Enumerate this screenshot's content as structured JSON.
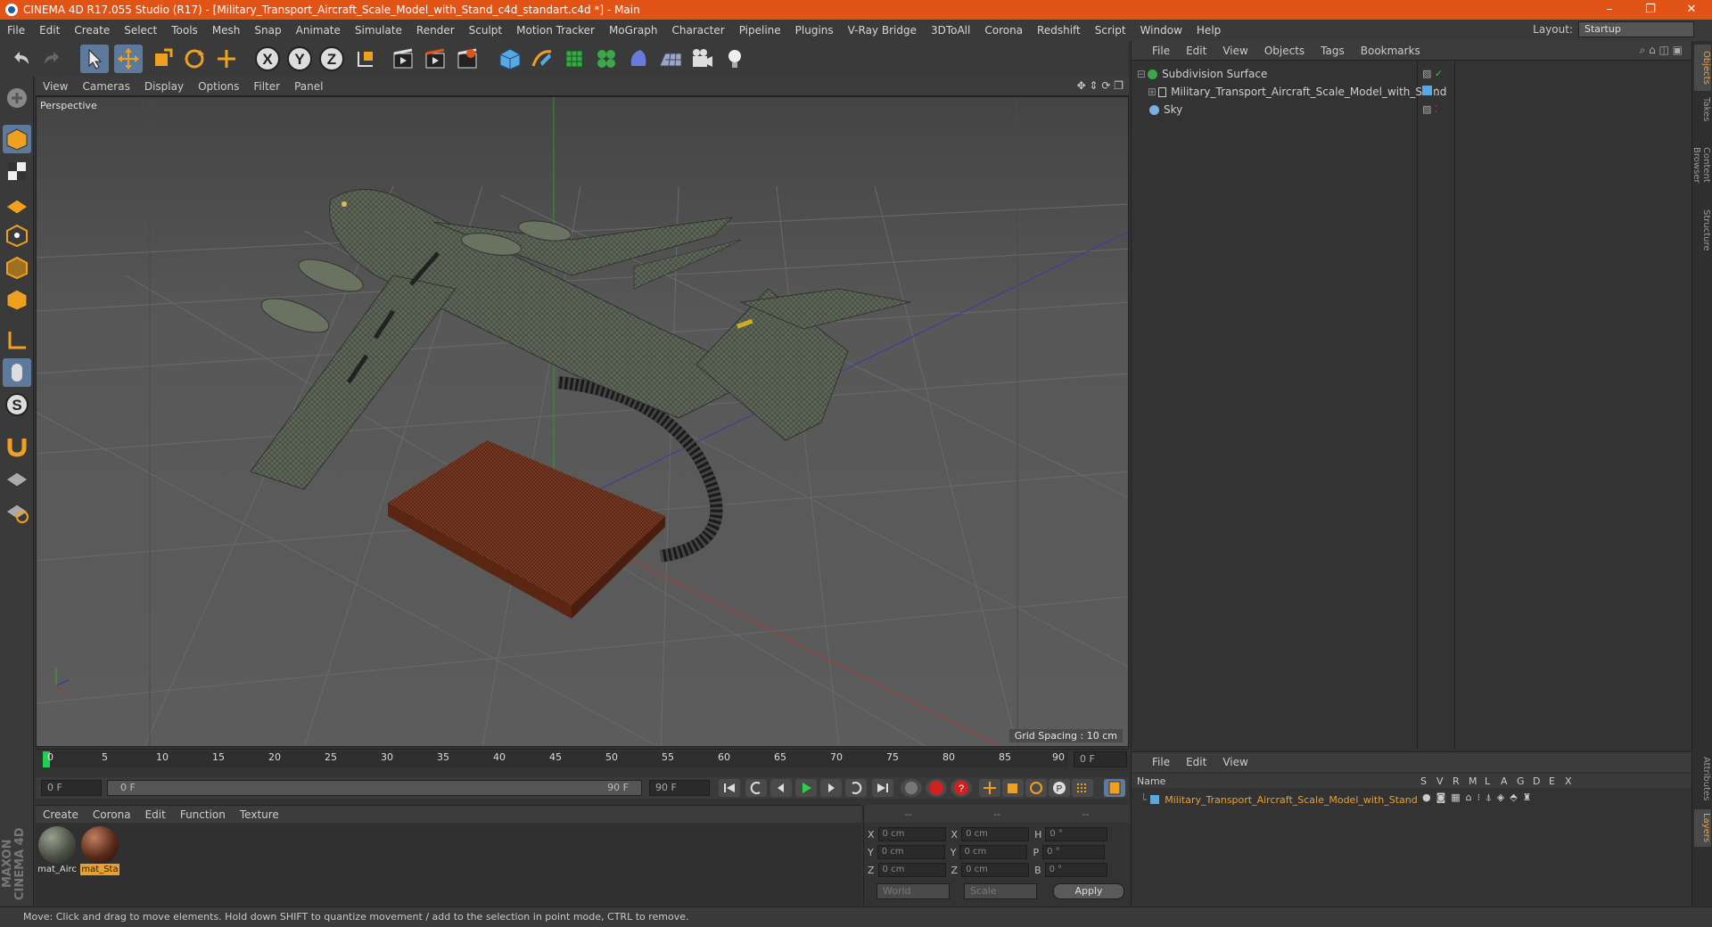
{
  "window": {
    "title": "CINEMA 4D R17.055 Studio (R17) - [Military_Transport_Aircraft_Scale_Model_with_Stand_c4d_standart.c4d *] - Main",
    "minimize": "–",
    "restore": "❐",
    "close": "✕"
  },
  "menubar": {
    "items": [
      "File",
      "Edit",
      "Create",
      "Select",
      "Tools",
      "Mesh",
      "Snap",
      "Animate",
      "Simulate",
      "Render",
      "Sculpt",
      "Motion Tracker",
      "MoGraph",
      "Character",
      "Pipeline",
      "Plugins",
      "V-Ray Bridge",
      "3DToAll",
      "Corona",
      "Redshift",
      "Script",
      "Window",
      "Help"
    ],
    "layout_label": "Layout:",
    "layout_value": "Startup"
  },
  "toolbar": {
    "axis_x": "X",
    "axis_y": "Y",
    "axis_z": "Z"
  },
  "viewport": {
    "menu": [
      "View",
      "Cameras",
      "Display",
      "Options",
      "Filter",
      "Panel"
    ],
    "label": "Perspective",
    "grid_spacing": "Grid Spacing : 10 cm"
  },
  "timeline": {
    "ticks": [
      "0",
      "5",
      "10",
      "15",
      "20",
      "25",
      "30",
      "35",
      "40",
      "45",
      "50",
      "55",
      "60",
      "65",
      "70",
      "75",
      "80",
      "85",
      "90"
    ],
    "current_frame": "0 F"
  },
  "transport": {
    "start": "0 F",
    "range_start": "0 F",
    "range_end": "90 F",
    "end": "90 F"
  },
  "materials": {
    "menu": [
      "Create",
      "Corona",
      "Edit",
      "Function",
      "Texture"
    ],
    "items": [
      {
        "name": "mat_Aircraft",
        "label": "mat_Airc",
        "color": "#4a5044"
      },
      {
        "name": "mat_Stand",
        "label": "mat_Sta",
        "color": "#5a2a1a"
      }
    ]
  },
  "coords": {
    "header": [
      "--",
      "--",
      "--"
    ],
    "rows": [
      {
        "a": "X",
        "av": "0 cm",
        "b": "X",
        "bv": "0 cm",
        "c": "H",
        "cv": "0 °"
      },
      {
        "a": "Y",
        "av": "0 cm",
        "b": "Y",
        "bv": "0 cm",
        "c": "P",
        "cv": "0 °"
      },
      {
        "a": "Z",
        "av": "0 cm",
        "b": "Z",
        "bv": "0 cm",
        "c": "B",
        "cv": "0 °"
      }
    ],
    "mode": "World",
    "scale": "Scale",
    "apply": "Apply"
  },
  "objects": {
    "menu": [
      "File",
      "Edit",
      "View",
      "Objects",
      "Tags",
      "Bookmarks"
    ],
    "items": [
      {
        "name": "Subdivision Surface"
      },
      {
        "name": "Military_Transport_Aircraft_Scale_Model_with_Stand"
      },
      {
        "name": "Sky"
      }
    ]
  },
  "layers": {
    "menu": [
      "File",
      "Edit",
      "View"
    ],
    "head_name": "Name",
    "cols": [
      "S",
      "V",
      "R",
      "M",
      "L",
      "A",
      "G",
      "D",
      "E",
      "X"
    ],
    "item": "Military_Transport_Aircraft_Scale_Model_with_Stand"
  },
  "sidetabs": [
    "Objects",
    "Takes",
    "Content Browser",
    "Structure",
    "Attributes",
    "Layers"
  ],
  "brand": "MAXON CINEMA 4D",
  "status": "Move: Click and drag to move elements. Hold down SHIFT to quantize movement / add to the selection in point mode, CTRL to remove.",
  "colors": {
    "accent": "#e25316",
    "selected": "#5d7a9c",
    "layer_text": "#e8a030"
  }
}
